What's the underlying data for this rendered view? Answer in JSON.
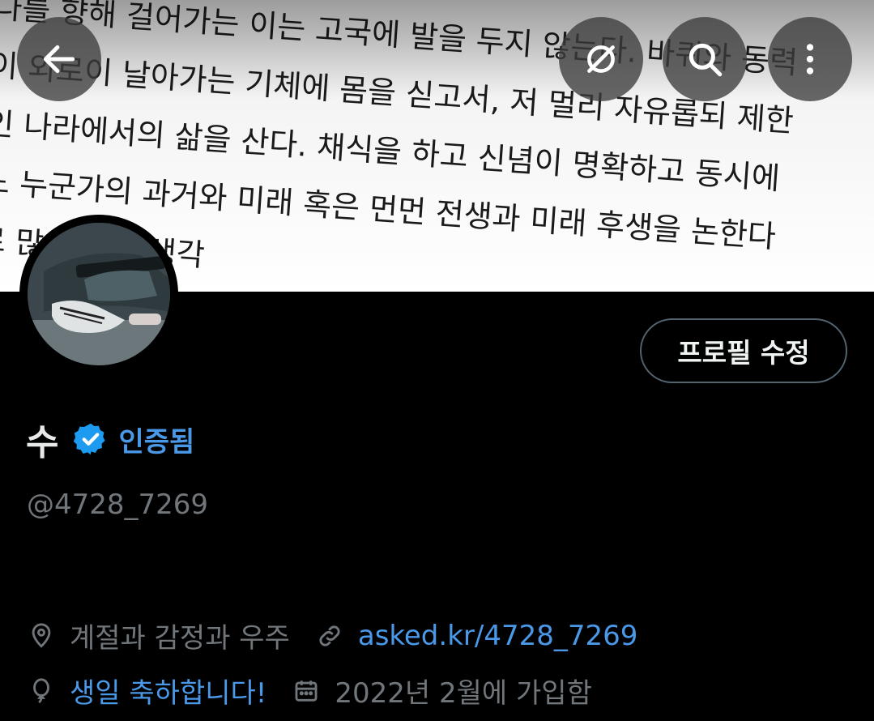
{
  "banner": {
    "lines": [
      "바다를 향해 걸어가는 이는 고국에 발을 두지 않는다. 바퀴와 동력",
      "없이 외로이 날아가는 기체에 몸을 싣고서, 저 멀리 자유롭되 제한",
      "적인 나라에서의 삶을 산다. 채식을 하고 신념이 명확하고 동시에",
      "어느 누군가의 과거와 미래 혹은 먼먼 전생과 미래 후생을 논한다",
      "으로 많은 것을 생각"
    ]
  },
  "toolbar": {
    "back_icon": "arrow-left-icon",
    "translate_icon": "translate-icon",
    "search_icon": "search-icon",
    "more_icon": "more-vertical-icon"
  },
  "profile": {
    "edit_label": "프로필 수정",
    "name": "수",
    "verified_label": "인증됨",
    "handle": "@4728_7269",
    "location": "계절과 감정과 우주",
    "link": "asked.kr/4728_7269",
    "birthday": "생일 축하합니다!",
    "joined": "2022년 2월에 가입함"
  },
  "colors": {
    "background": "#000000",
    "accent": "#4a99e9",
    "muted": "#71767b",
    "verified": "#1d9bf0"
  }
}
